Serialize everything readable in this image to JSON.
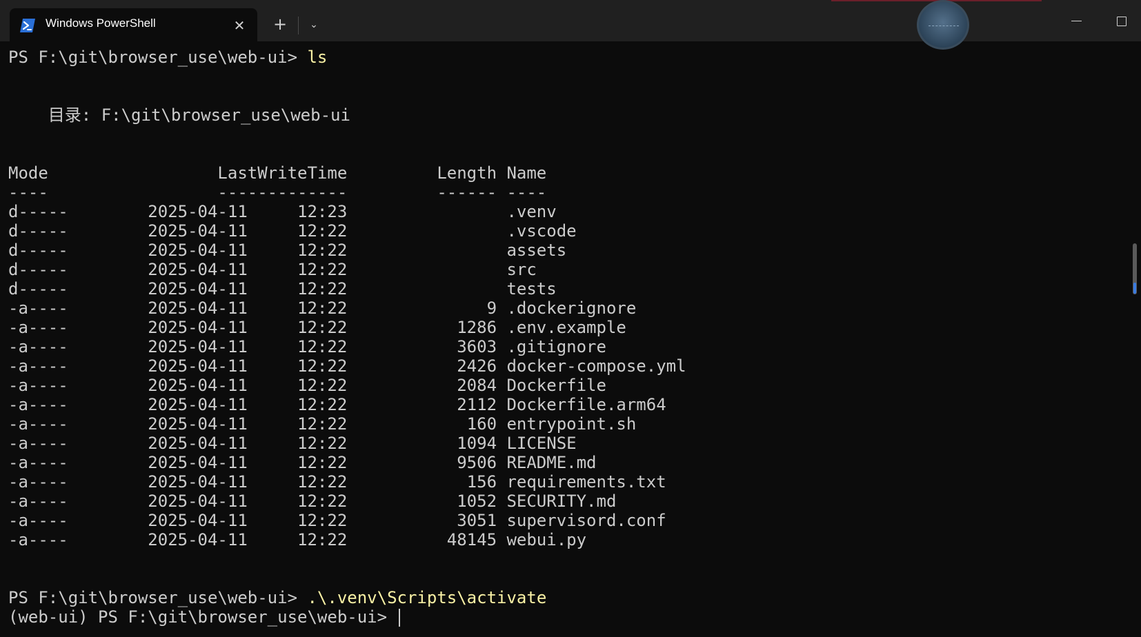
{
  "window": {
    "tab_title": "Windows PowerShell",
    "close_symbol": "✕",
    "new_tab_symbol": "+",
    "dropdown_symbol": "⌄",
    "icons": [
      "powershell-icon",
      "close-icon",
      "plus-icon",
      "chevron-down-icon",
      "minimize-icon",
      "maximize-icon"
    ]
  },
  "terminal": {
    "prompt1": "PS F:\\git\\browser_use\\web-ui> ",
    "command1": "ls",
    "directory_line": "    目录: F:\\git\\browser_use\\web-ui",
    "header": "Mode                 LastWriteTime         Length Name",
    "separator": "----                 -------------         ------ ----",
    "rows": [
      "d-----        2025-04-11     12:23                .venv",
      "d-----        2025-04-11     12:22                .vscode",
      "d-----        2025-04-11     12:22                assets",
      "d-----        2025-04-11     12:22                src",
      "d-----        2025-04-11     12:22                tests",
      "-a----        2025-04-11     12:22              9 .dockerignore",
      "-a----        2025-04-11     12:22           1286 .env.example",
      "-a----        2025-04-11     12:22           3603 .gitignore",
      "-a----        2025-04-11     12:22           2426 docker-compose.yml",
      "-a----        2025-04-11     12:22           2084 Dockerfile",
      "-a----        2025-04-11     12:22           2112 Dockerfile.arm64",
      "-a----        2025-04-11     12:22            160 entrypoint.sh",
      "-a----        2025-04-11     12:22           1094 LICENSE",
      "-a----        2025-04-11     12:22           9506 README.md",
      "-a----        2025-04-11     12:22            156 requirements.txt",
      "-a----        2025-04-11     12:22           1052 SECURITY.md",
      "-a----        2025-04-11     12:22           3051 supervisord.conf",
      "-a----        2025-04-11     12:22          48145 webui.py"
    ],
    "prompt2": "PS F:\\git\\browser_use\\web-ui> ",
    "command2": ".\\.venv\\Scripts\\activate",
    "prompt3": "(web-ui) PS F:\\git\\browser_use\\web-ui> "
  },
  "colors": {
    "background": "#0c0c0c",
    "titlebar": "#202020",
    "text": "#cccccc",
    "command": "#f9f1a5",
    "accent": "#3b7be0"
  }
}
